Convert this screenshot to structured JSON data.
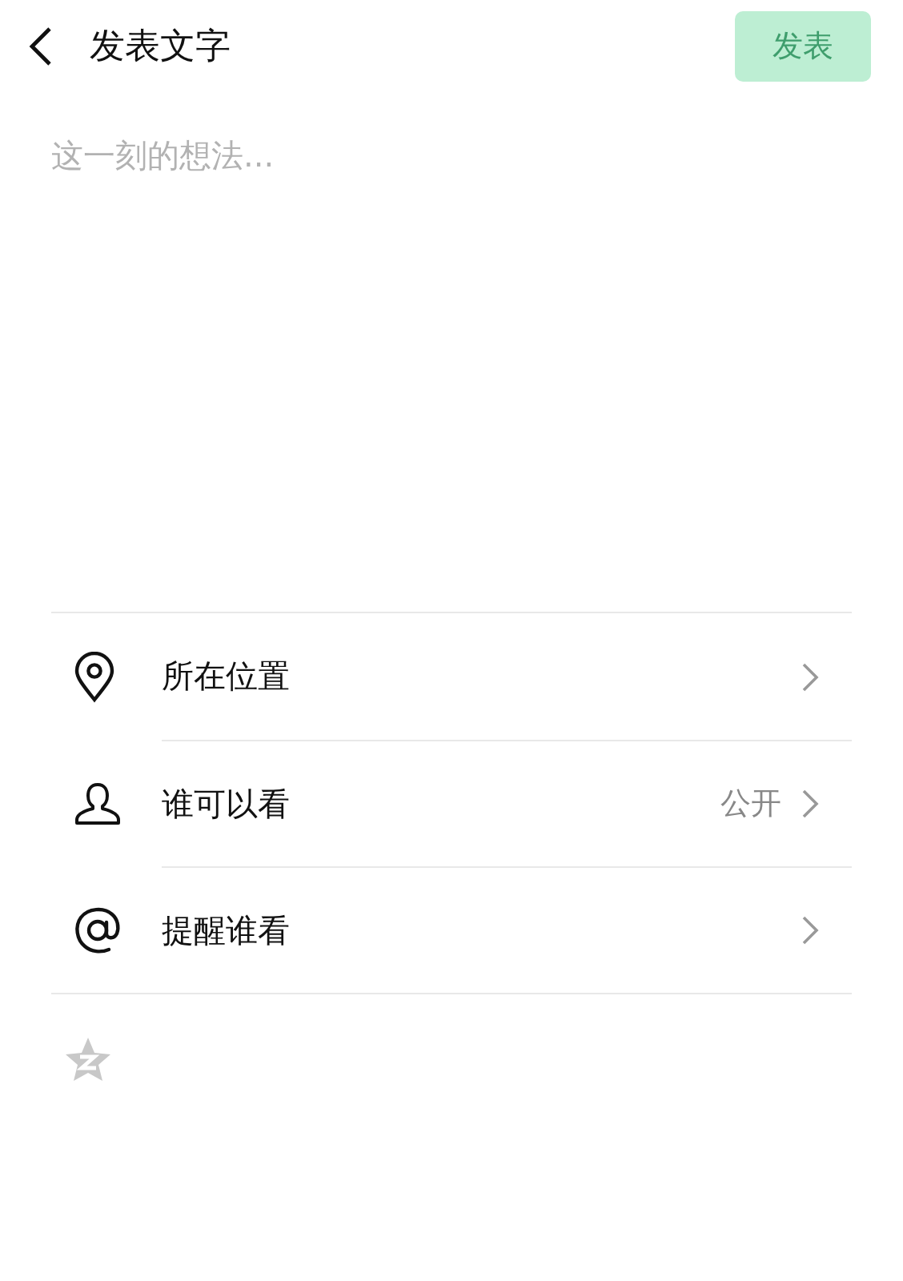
{
  "header": {
    "title": "发表文字",
    "publish_button": {
      "label": "发表",
      "disabled": true
    }
  },
  "post_field": {
    "placeholder": "这一刻的想法..."
  },
  "options": [
    {
      "kind": "location",
      "label": "所在位置"
    },
    {
      "kind": "person",
      "label": "谁可以看",
      "value": "公开"
    },
    {
      "kind": "mention",
      "label": "提醒谁看"
    }
  ]
}
